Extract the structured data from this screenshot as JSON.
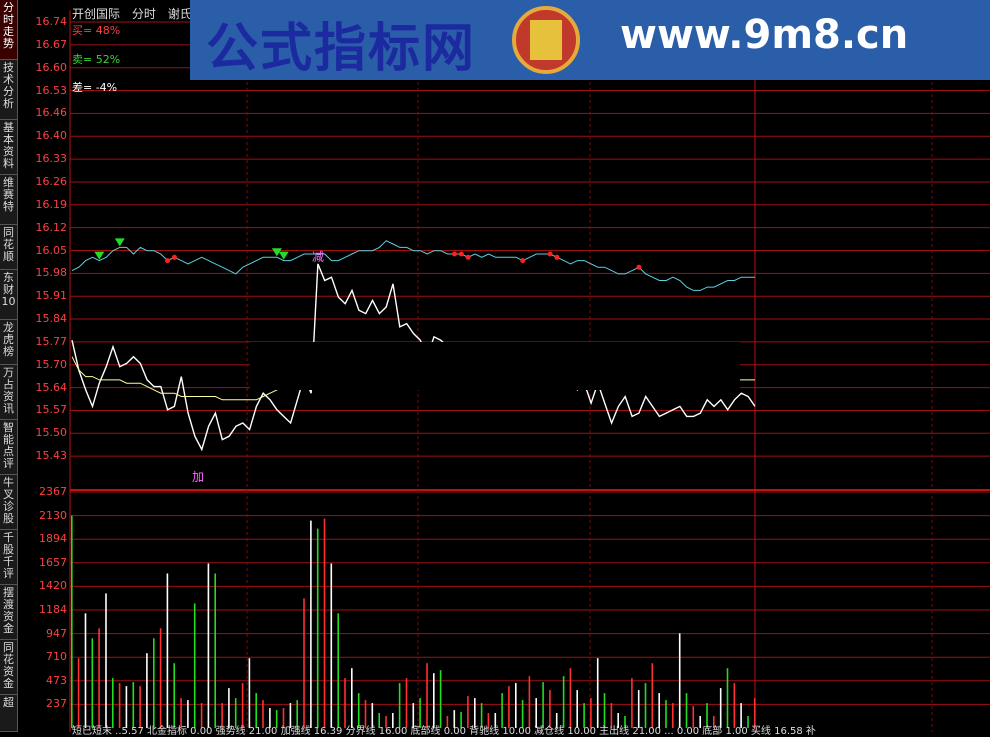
{
  "sidebar": {
    "tabs": [
      {
        "label": "分时走势",
        "active": true
      },
      {
        "label": "技术分析"
      },
      {
        "label": "基本资料"
      },
      {
        "label": "维赛特"
      },
      {
        "label": "同花顺"
      },
      {
        "label": "东财10"
      },
      {
        "label": "龙虎榜"
      },
      {
        "label": "万占资讯"
      },
      {
        "label": "智能点评"
      },
      {
        "label": "牛叉诊股"
      },
      {
        "label": "千股千评"
      },
      {
        "label": "摆渡资金"
      },
      {
        "label": "同花资金"
      },
      {
        "label": "超"
      }
    ]
  },
  "header": {
    "stock_name": "开创国际",
    "mode": "分时",
    "indicator": "谢氏分"
  },
  "stats": {
    "buy": "买= 48%",
    "sell": "卖= 52%",
    "diff": "差= -4%"
  },
  "banner": {
    "title": "公式指标网",
    "url": "www.9m8.cn",
    "logo_text": "www.9m8.cn"
  },
  "price_axis": [
    "16.74",
    "16.67",
    "16.60",
    "16.53",
    "16.46",
    "16.40",
    "16.33",
    "16.26",
    "16.19",
    "16.12",
    "16.05",
    "15.98",
    "15.91",
    "15.84",
    "15.77",
    "15.70",
    "15.64",
    "15.57",
    "15.50",
    "15.43"
  ],
  "volume_axis": [
    "2367",
    "2130",
    "1894",
    "1657",
    "1420",
    "1184",
    "947",
    "710",
    "473",
    "237"
  ],
  "markers": {
    "add_label": "加",
    "reduce_label": "减"
  },
  "footer": {
    "text": "短已短末 ..5.57 北金指标 0.00 强势线 21.00 加强线 16.39 分界线 16.00 底部线 0.00 背驰线 10.00 减仓线 10.00 主出线 21.00 ... 0.00 底部 1.00 买线 16.58 补"
  },
  "chart_data": {
    "type": "line",
    "price_axis_range": [
      15.43,
      16.74
    ],
    "volume_axis_range": [
      0,
      2367
    ],
    "series": [
      {
        "name": "price",
        "color": "#ffffff",
        "values": [
          15.78,
          15.69,
          15.63,
          15.58,
          15.65,
          15.7,
          15.76,
          15.7,
          15.71,
          15.73,
          15.71,
          15.66,
          15.64,
          15.64,
          15.57,
          15.58,
          15.67,
          15.56,
          15.49,
          15.45,
          15.52,
          15.56,
          15.48,
          15.49,
          15.52,
          15.53,
          15.51,
          15.58,
          15.62,
          15.6,
          15.57,
          15.55,
          15.53,
          15.6,
          15.67,
          15.62,
          16.01,
          15.96,
          15.97,
          15.91,
          15.89,
          15.93,
          15.87,
          15.86,
          15.9,
          15.86,
          15.88,
          15.95,
          15.82,
          15.83,
          15.8,
          15.78,
          15.73,
          15.79,
          15.78,
          15.76,
          15.74,
          15.72,
          15.72,
          15.72,
          15.75,
          15.71,
          15.7,
          15.69,
          15.7,
          15.69,
          15.68,
          15.72,
          15.71,
          15.69,
          15.68,
          15.69,
          15.7,
          15.66,
          15.63,
          15.65,
          15.59,
          15.65,
          15.59,
          15.53,
          15.58,
          15.61,
          15.55,
          15.56,
          15.61,
          15.58,
          15.55,
          15.56,
          15.57,
          15.58,
          15.55,
          15.55,
          15.56,
          15.6,
          15.58,
          15.6,
          15.57,
          15.6,
          15.62,
          15.61,
          15.58
        ]
      },
      {
        "name": "avg",
        "color": "#ffff99",
        "values": [
          15.73,
          15.69,
          15.67,
          15.67,
          15.66,
          15.66,
          15.66,
          15.66,
          15.65,
          15.65,
          15.65,
          15.64,
          15.63,
          15.62,
          15.62,
          15.62,
          15.61,
          15.61,
          15.61,
          15.61,
          15.61,
          15.61,
          15.6,
          15.6,
          15.6,
          15.6,
          15.6,
          15.6,
          15.61,
          15.62,
          15.63,
          15.64,
          15.65,
          15.66,
          15.66,
          15.66,
          15.66,
          15.66,
          15.66,
          15.66,
          15.66,
          15.66,
          15.66,
          15.66,
          15.66,
          15.66,
          15.66,
          15.66,
          15.66,
          15.66,
          15.66,
          15.66,
          15.66,
          15.66,
          15.66,
          15.66,
          15.66,
          15.66,
          15.66,
          15.66,
          15.66,
          15.66,
          15.66,
          15.66,
          15.66,
          15.66,
          15.66,
          15.66,
          15.66,
          15.66,
          15.66,
          15.66,
          15.66,
          15.66,
          15.66,
          15.66,
          15.66,
          15.66,
          15.66,
          15.66,
          15.66,
          15.66,
          15.66,
          15.66,
          15.66,
          15.66,
          15.66,
          15.66,
          15.66,
          15.66,
          15.66,
          15.66,
          15.66,
          15.66,
          15.66,
          15.66,
          15.66,
          15.66,
          15.66,
          15.66,
          15.66
        ]
      },
      {
        "name": "indicator",
        "color": "#5ad1e0",
        "values": [
          15.99,
          16.0,
          16.02,
          16.03,
          16.02,
          16.03,
          16.05,
          16.06,
          16.06,
          16.04,
          16.06,
          16.05,
          16.05,
          16.04,
          16.02,
          16.03,
          16.02,
          16.01,
          16.02,
          16.03,
          16.02,
          16.01,
          16.0,
          15.99,
          15.98,
          16.0,
          16.01,
          16.02,
          16.03,
          16.03,
          16.03,
          16.02,
          16.02,
          16.03,
          16.04,
          16.04,
          16.04,
          16.04,
          16.02,
          16.02,
          16.03,
          16.04,
          16.05,
          16.05,
          16.05,
          16.06,
          16.08,
          16.07,
          16.06,
          16.06,
          16.05,
          16.05,
          16.04,
          16.05,
          16.05,
          16.04,
          16.04,
          16.04,
          16.03,
          16.04,
          16.03,
          16.04,
          16.03,
          16.03,
          16.03,
          16.03,
          16.02,
          16.03,
          16.04,
          16.04,
          16.04,
          16.03,
          16.02,
          16.01,
          16.02,
          16.02,
          16.01,
          16.0,
          16.0,
          15.99,
          15.98,
          15.98,
          15.99,
          16.0,
          15.98,
          15.97,
          15.96,
          15.96,
          15.97,
          15.96,
          15.94,
          15.93,
          15.93,
          15.94,
          15.94,
          15.95,
          15.96,
          15.96,
          15.97,
          15.97,
          15.97
        ]
      }
    ],
    "volume": [
      2130,
      700,
      1150,
      900,
      1000,
      1350,
      500,
      450,
      420,
      460,
      420,
      750,
      900,
      1000,
      1550,
      650,
      300,
      280,
      1250,
      250,
      1650,
      1550,
      250,
      400,
      300,
      450,
      700,
      350,
      280,
      200,
      180,
      200,
      250,
      280,
      1300,
      2080,
      2000,
      2100,
      1650,
      1150,
      500,
      600,
      350,
      280,
      250,
      150,
      120,
      150,
      450,
      500,
      250,
      300,
      650,
      550,
      580,
      120,
      180,
      160,
      320,
      300,
      250,
      150,
      150,
      350,
      420,
      450,
      280,
      520,
      300,
      460,
      380,
      150,
      520,
      600,
      380,
      250,
      300,
      700,
      350,
      250,
      150,
      120,
      500,
      380,
      450,
      650,
      350,
      280,
      250,
      950,
      350,
      220,
      120,
      250,
      120,
      400,
      600,
      450,
      250,
      120,
      300
    ],
    "volume_colors_note": "red=up, green=down, white=flat"
  }
}
